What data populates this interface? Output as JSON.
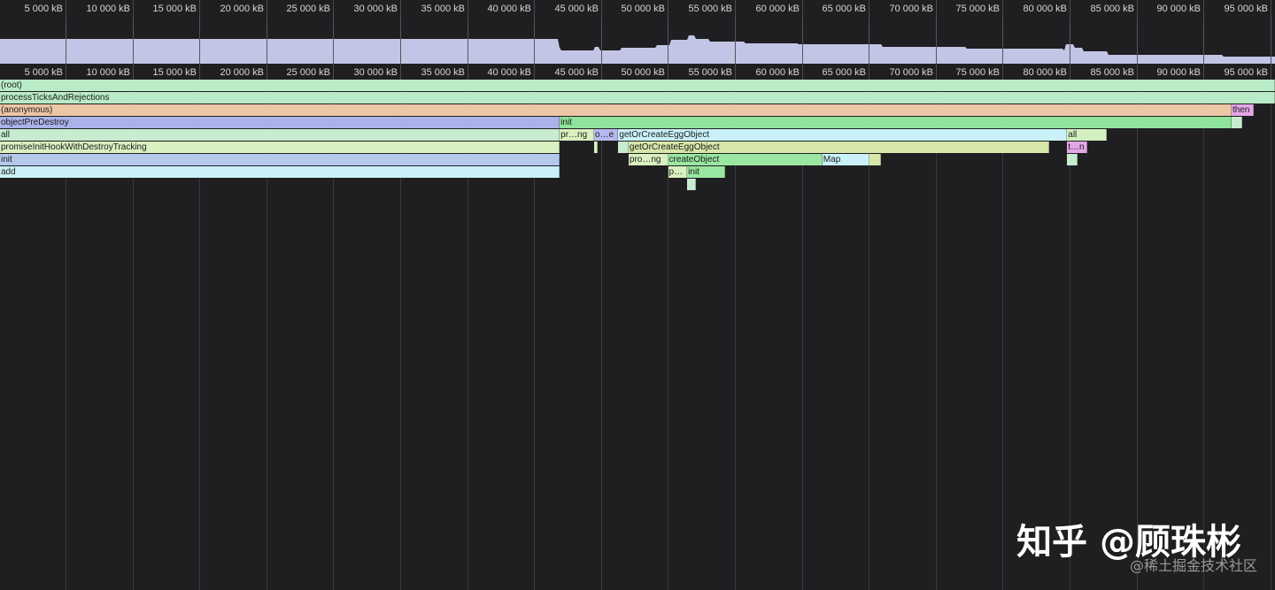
{
  "ruler_labels": [
    "5 000 kB",
    "10 000 kB",
    "15 000 kB",
    "20 000 kB",
    "25 000 kB",
    "30 000 kB",
    "35 000 kB",
    "40 000 kB",
    "45 000 kB",
    "50 000 kB",
    "55 000 kB",
    "60 000 kB",
    "65 000 kB",
    "70 000 kB",
    "75 000 kB",
    "80 000 kB",
    "85 000 kB",
    "90 000 kB",
    "95 000 kB"
  ],
  "overview_color": "#c3c5e6",
  "frames": [
    {
      "label": "(root)",
      "depth": 0,
      "start": 0,
      "end": 100,
      "color": "#b9ecc6"
    },
    {
      "label": "processTicksAndRejections",
      "depth": 1,
      "start": 0,
      "end": 100,
      "color": "#b9ecc6"
    },
    {
      "label": "(anonymous)",
      "depth": 2,
      "start": 0,
      "end": 96.6,
      "color": "#edc6a6"
    },
    {
      "label": "then",
      "depth": 2,
      "start": 96.6,
      "end": 98.3,
      "color": "#e3a7e8"
    },
    {
      "label": "objectPreDestroy",
      "depth": 3,
      "start": 0,
      "end": 43.9,
      "color": "#aab2ea"
    },
    {
      "label": "init",
      "depth": 3,
      "start": 43.9,
      "end": 96.6,
      "color": "#8fe39a"
    },
    {
      "label": "",
      "depth": 3,
      "start": 96.6,
      "end": 97.4,
      "color": "#c8ecd0"
    },
    {
      "label": "all",
      "depth": 4,
      "start": 0,
      "end": 43.9,
      "color": "#c8ecd0"
    },
    {
      "label": "pr…ng",
      "depth": 4,
      "start": 43.9,
      "end": 46.6,
      "color": "#d9f0c0"
    },
    {
      "label": "o…e",
      "depth": 4,
      "start": 46.6,
      "end": 48.5,
      "color": "#b6b9ee"
    },
    {
      "label": "getOrCreateEggObject",
      "depth": 4,
      "start": 48.5,
      "end": 83.7,
      "color": "#c9f1f7"
    },
    {
      "label": "all",
      "depth": 4,
      "start": 83.7,
      "end": 86.8,
      "color": "#d3f0c0"
    },
    {
      "label": "promiseInitHookWithDestroyTracking",
      "depth": 5,
      "start": 0,
      "end": 43.9,
      "color": "#d9f0c0"
    },
    {
      "label": "",
      "depth": 5,
      "start": 46.6,
      "end": 46.9,
      "color": "#d9f0c0"
    },
    {
      "label": "",
      "depth": 5,
      "start": 48.5,
      "end": 49.3,
      "color": "#c8ecd0"
    },
    {
      "label": "getOrCreateEggObject",
      "depth": 5,
      "start": 49.3,
      "end": 82.3,
      "color": "#d6e7a9"
    },
    {
      "label": "t…n",
      "depth": 5,
      "start": 83.7,
      "end": 85.3,
      "color": "#e3a7e8"
    },
    {
      "label": "init",
      "depth": 6,
      "start": 0,
      "end": 43.9,
      "color": "#b5c9ed"
    },
    {
      "label": "pro…ng",
      "depth": 6,
      "start": 49.3,
      "end": 52.4,
      "color": "#d9f0c0"
    },
    {
      "label": "createObject",
      "depth": 6,
      "start": 52.4,
      "end": 64.5,
      "color": "#9ae7a2"
    },
    {
      "label": "Map",
      "depth": 6,
      "start": 64.5,
      "end": 68.2,
      "color": "#c9f1f7"
    },
    {
      "label": "",
      "depth": 6,
      "start": 68.2,
      "end": 69.1,
      "color": "#d6e7a9"
    },
    {
      "label": "",
      "depth": 6,
      "start": 83.7,
      "end": 84.5,
      "color": "#c8ecd0"
    },
    {
      "label": "add",
      "depth": 7,
      "start": 0,
      "end": 43.9,
      "color": "#c9f1f7"
    },
    {
      "label": "p…",
      "depth": 7,
      "start": 52.4,
      "end": 53.9,
      "color": "#d9f0c0"
    },
    {
      "label": "init",
      "depth": 7,
      "start": 53.9,
      "end": 56.9,
      "color": "#9ae7a2"
    },
    {
      "label": "",
      "depth": 8,
      "start": 53.9,
      "end": 54.6,
      "color": "#c8ecd0"
    }
  ],
  "watermark": {
    "main": "知乎 @顾珠彬",
    "sub": "@稀土掘金技术社区"
  }
}
